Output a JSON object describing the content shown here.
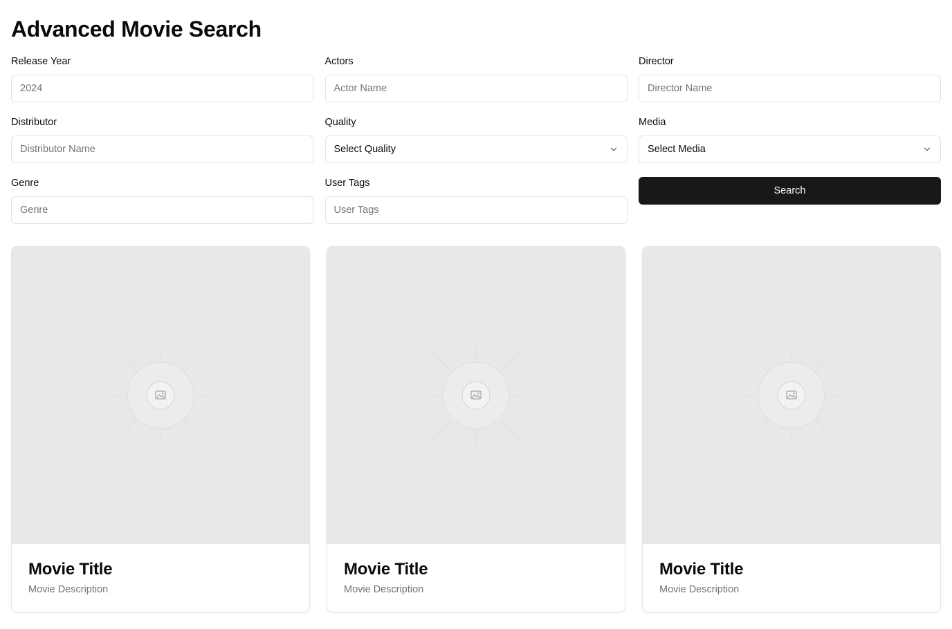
{
  "page": {
    "title": "Advanced Movie Search"
  },
  "form": {
    "release_year": {
      "label": "Release Year",
      "placeholder": "2024",
      "value": ""
    },
    "actors": {
      "label": "Actors",
      "placeholder": "Actor Name",
      "value": ""
    },
    "director": {
      "label": "Director",
      "placeholder": "Director Name",
      "value": ""
    },
    "distributor": {
      "label": "Distributor",
      "placeholder": "Distributor Name",
      "value": ""
    },
    "quality": {
      "label": "Quality",
      "selected": "Select Quality"
    },
    "media": {
      "label": "Media",
      "selected": "Select Media"
    },
    "genre": {
      "label": "Genre",
      "placeholder": "Genre",
      "value": ""
    },
    "user_tags": {
      "label": "User Tags",
      "placeholder": "User Tags",
      "value": ""
    },
    "search_label": "Search"
  },
  "icons": {
    "select_chevron": "chevron-down-icon",
    "placeholder_image": "image-icon"
  },
  "colors": {
    "primary_button": "#18181b",
    "image_placeholder": "#e8e8e8",
    "muted_text": "#737373",
    "border": "#e4e4e7"
  },
  "results": [
    {
      "title": "Movie Title",
      "description": "Movie Description"
    },
    {
      "title": "Movie Title",
      "description": "Movie Description"
    },
    {
      "title": "Movie Title",
      "description": "Movie Description"
    }
  ]
}
